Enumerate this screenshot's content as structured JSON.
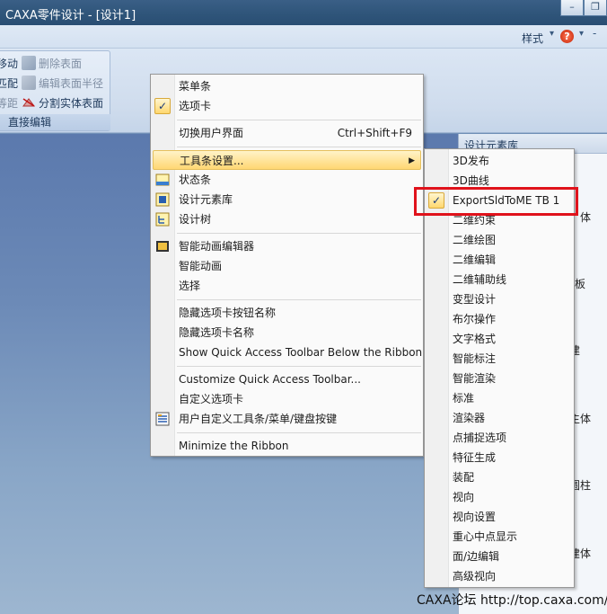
{
  "window": {
    "title": "CAXA零件设计 - [设计1]",
    "min_label": "–",
    "max_label": "❐"
  },
  "ribbon_top": {
    "style_label": "样式",
    "help_label": "?"
  },
  "ribbon_group": {
    "label": "直接编辑",
    "items": [
      {
        "left_fragment": "移动",
        "action": "删除表面",
        "icon": "delete-face-icon"
      },
      {
        "left_fragment": "匹配",
        "action": "编辑表面半径",
        "icon": "edit-face-radius-icon"
      },
      {
        "left_fragment": "等距",
        "action": "分割实体表面",
        "icon": "split-face-icon"
      }
    ]
  },
  "right_panel": {
    "header": "设计元素库",
    "fragments": [
      "体",
      "板",
      "建",
      "主体",
      "圆柱",
      "建体"
    ]
  },
  "context_menu": {
    "items": [
      {
        "label": "菜单条",
        "checked": false
      },
      {
        "label": "选项卡",
        "checked": true
      },
      {
        "label": "切换用户界面",
        "shortcut": "Ctrl+Shift+F9"
      },
      {
        "label": "工具条设置...",
        "submenu": true,
        "highlighted": true
      },
      {
        "label": "状态条",
        "icon": "status-bar-icon"
      },
      {
        "label": "设计元素库",
        "icon": "design-library-icon"
      },
      {
        "label": "设计树",
        "icon": "design-tree-icon"
      },
      {
        "label": "智能动画编辑器",
        "icon": "animation-editor-icon"
      },
      {
        "label": "智能动画"
      },
      {
        "label": "选择"
      },
      {
        "label": "隐藏选项卡按钮名称"
      },
      {
        "label": "隐藏选项卡名称"
      },
      {
        "label": "Show Quick Access Toolbar Below the Ribbon"
      },
      {
        "label": "Customize Quick Access Toolbar..."
      },
      {
        "label": "自定义选项卡"
      },
      {
        "label": "用户自定义工具条/菜单/键盘按键",
        "icon": "customize-icon"
      },
      {
        "label": "Minimize the Ribbon"
      }
    ]
  },
  "toolbar_submenu": {
    "items": [
      {
        "label": "3D发布"
      },
      {
        "label": "3D曲线"
      },
      {
        "label": "ExportSldToME TB 1",
        "checked": true
      },
      {
        "label": "二维约束"
      },
      {
        "label": "二维绘图"
      },
      {
        "label": "二维编辑"
      },
      {
        "label": "二维辅助线"
      },
      {
        "label": "变型设计"
      },
      {
        "label": "布尔操作"
      },
      {
        "label": "文字格式"
      },
      {
        "label": "智能标注"
      },
      {
        "label": "智能渲染"
      },
      {
        "label": "标准"
      },
      {
        "label": "渲染器"
      },
      {
        "label": "点捕捉选项"
      },
      {
        "label": "特征生成"
      },
      {
        "label": "装配"
      },
      {
        "label": "视向"
      },
      {
        "label": "视向设置"
      },
      {
        "label": "重心中点显示"
      },
      {
        "label": "面/边编辑"
      },
      {
        "label": "高级视向"
      }
    ]
  },
  "watermark": "CAXA论坛 http://top.caxa.com/",
  "colors": {
    "highlight": "#ffd773",
    "annotation_box": "#e0121b",
    "canvas_top": "#5b79ad"
  }
}
